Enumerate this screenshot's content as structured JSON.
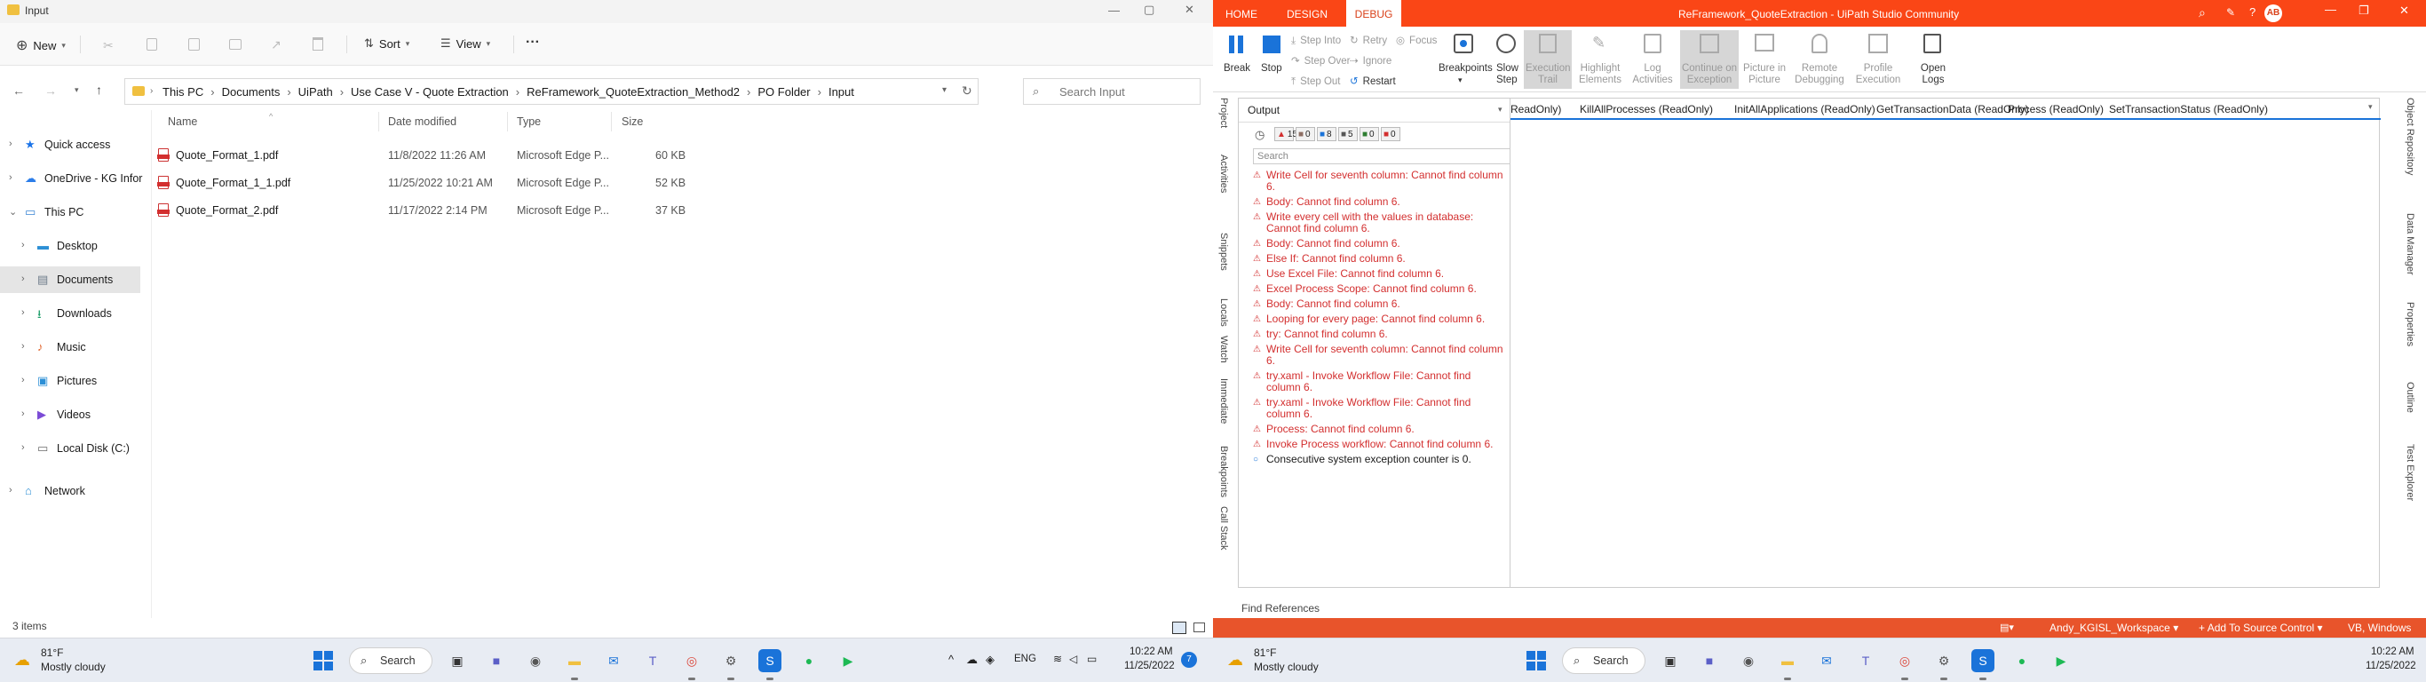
{
  "explorer": {
    "title": "Input",
    "window_controls": [
      "—",
      "▢",
      "✕"
    ],
    "toolbar": {
      "new_label": "New",
      "sort_label": "Sort",
      "view_label": "View",
      "more_label": "···"
    },
    "breadcrumb": [
      "This PC",
      "Documents",
      "UiPath",
      "Use Case V - Quote Extraction",
      "ReFramework_QuoteExtraction_Method2",
      "PO Folder",
      "Input"
    ],
    "search_placeholder": "Search Input",
    "nav_items": [
      {
        "label": "Quick access",
        "icon": "star-icon",
        "color": "#1a73e8",
        "indent": 0
      },
      {
        "label": "OneDrive - KG Infor",
        "icon": "cloud-icon",
        "color": "#2b7de9",
        "indent": 0
      },
      {
        "label": "This PC",
        "icon": "pc-icon",
        "color": "#3a86d4",
        "indent": 0
      },
      {
        "label": "Desktop",
        "icon": "desktop-icon",
        "color": "#2d8fd5",
        "indent": 1
      },
      {
        "label": "Documents",
        "icon": "documents-icon",
        "color": "#6c7a89",
        "indent": 1,
        "selected": true
      },
      {
        "label": "Downloads",
        "icon": "download-icon",
        "color": "#1e9e6a",
        "indent": 1
      },
      {
        "label": "Music",
        "icon": "music-icon",
        "color": "#e0642c",
        "indent": 1
      },
      {
        "label": "Pictures",
        "icon": "pictures-icon",
        "color": "#2c8fd6",
        "indent": 1
      },
      {
        "label": "Videos",
        "icon": "video-icon",
        "color": "#7b4bd6",
        "indent": 1
      },
      {
        "label": "Local Disk (C:)",
        "icon": "disk-icon",
        "color": "#6a6a6a",
        "indent": 1
      },
      {
        "label": "Network",
        "icon": "network-icon",
        "color": "#2d8fd5",
        "indent": 0
      }
    ],
    "columns": [
      "Name",
      "Date modified",
      "Type",
      "Size"
    ],
    "files": [
      {
        "name": "Quote_Format_1.pdf",
        "date": "11/8/2022 11:26 AM",
        "type": "Microsoft Edge P...",
        "size": "60 KB"
      },
      {
        "name": "Quote_Format_1_1.pdf",
        "date": "11/25/2022 10:21 AM",
        "type": "Microsoft Edge P...",
        "size": "52 KB"
      },
      {
        "name": "Quote_Format_2.pdf",
        "date": "11/17/2022 2:14 PM",
        "type": "Microsoft Edge P...",
        "size": "37 KB"
      }
    ],
    "status_count": "3 items"
  },
  "studio": {
    "tabs": [
      "HOME",
      "DESIGN",
      "DEBUG"
    ],
    "active_tab": "DEBUG",
    "title": "ReFramework_QuoteExtraction - UiPath Studio Community",
    "user_initials": "AB",
    "ribbon": {
      "break": "Break",
      "stop": "Stop",
      "step_into": "Step Into",
      "step_over": "Step Over",
      "step_out": "Step Out",
      "retry": "Retry",
      "ignore": "Ignore",
      "restart": "Restart",
      "focus": "Focus",
      "breakpoints": "Breakpoints",
      "slow_step_1": "Slow",
      "slow_step_2": "Step",
      "exec_trail_1": "Execution",
      "exec_trail_2": "Trail",
      "highlight_1": "Highlight",
      "highlight_2": "Elements",
      "log_1": "Log",
      "log_2": "Activities",
      "continue_1": "Continue on",
      "continue_2": "Exception",
      "pip_1": "Picture in",
      "pip_2": "Picture",
      "remote_1": "Remote",
      "remote_2": "Debugging",
      "profile_1": "Profile",
      "profile_2": "Execution",
      "openlogs_1": "Open",
      "openlogs_2": "Logs"
    },
    "left_vtabs": [
      "Project",
      "Activities",
      "Snippets",
      "Locals",
      "Watch",
      "Immediate",
      "Breakpoints",
      "Call Stack"
    ],
    "right_vtabs": [
      "Object Repository",
      "Data Manager",
      "Properties",
      "Outline",
      "Test Explorer"
    ],
    "output": {
      "title": "Output",
      "filters": [
        "15",
        "0",
        "8",
        "5",
        "0",
        "0"
      ],
      "search_placeholder": "Search",
      "lines": [
        {
          "level": "error",
          "text": "Write Cell for seventh column: Cannot find column 6."
        },
        {
          "level": "error",
          "text": "Body: Cannot find column 6."
        },
        {
          "level": "error",
          "text": "Write every cell with the values in database: Cannot find column 6."
        },
        {
          "level": "error",
          "text": "Body: Cannot find column 6."
        },
        {
          "level": "error",
          "text": "Else If: Cannot find column 6."
        },
        {
          "level": "error",
          "text": "Use Excel File: Cannot find column 6."
        },
        {
          "level": "error",
          "text": "Excel Process Scope: Cannot find column 6."
        },
        {
          "level": "error",
          "text": "Body: Cannot find column 6."
        },
        {
          "level": "error",
          "text": "Looping for every page: Cannot find column 6."
        },
        {
          "level": "error",
          "text": "try: Cannot find column 6."
        },
        {
          "level": "error",
          "text": "Write Cell for seventh column: Cannot find column 6."
        },
        {
          "level": "error",
          "text": "try.xaml - Invoke Workflow File: Cannot find column 6."
        },
        {
          "level": "error",
          "text": "try.xaml - Invoke Workflow File: Cannot find column 6."
        },
        {
          "level": "error",
          "text": "Process: Cannot find column 6."
        },
        {
          "level": "error",
          "text": "Invoke Process workflow: Cannot find column 6."
        },
        {
          "level": "info",
          "text": "Consecutive system exception counter is 0."
        }
      ]
    },
    "doc_tabs": [
      "ReadOnly)",
      "KillAllProcesses (ReadOnly)",
      "InitAllApplications (ReadOnly)",
      "GetTransactionData (ReadOnly)",
      "Process (ReadOnly)",
      "SetTransactionStatus (ReadOnly)"
    ],
    "find_references": "Find References",
    "status": {
      "workspace": "Andy_KGISL_Workspace",
      "source_control": "Add To Source Control",
      "target": "VB, Windows"
    }
  },
  "taskbar": {
    "left": {
      "temp": "81°F",
      "cond": "Mostly cloudy",
      "search": "Search",
      "lang": "ENG",
      "time": "10:22 AM",
      "date": "11/25/2022",
      "badge": "7"
    },
    "right": {
      "temp": "81°F",
      "cond": "Mostly cloudy",
      "search": "Search",
      "time": "10:22 AM",
      "date": "11/25/2022"
    }
  }
}
